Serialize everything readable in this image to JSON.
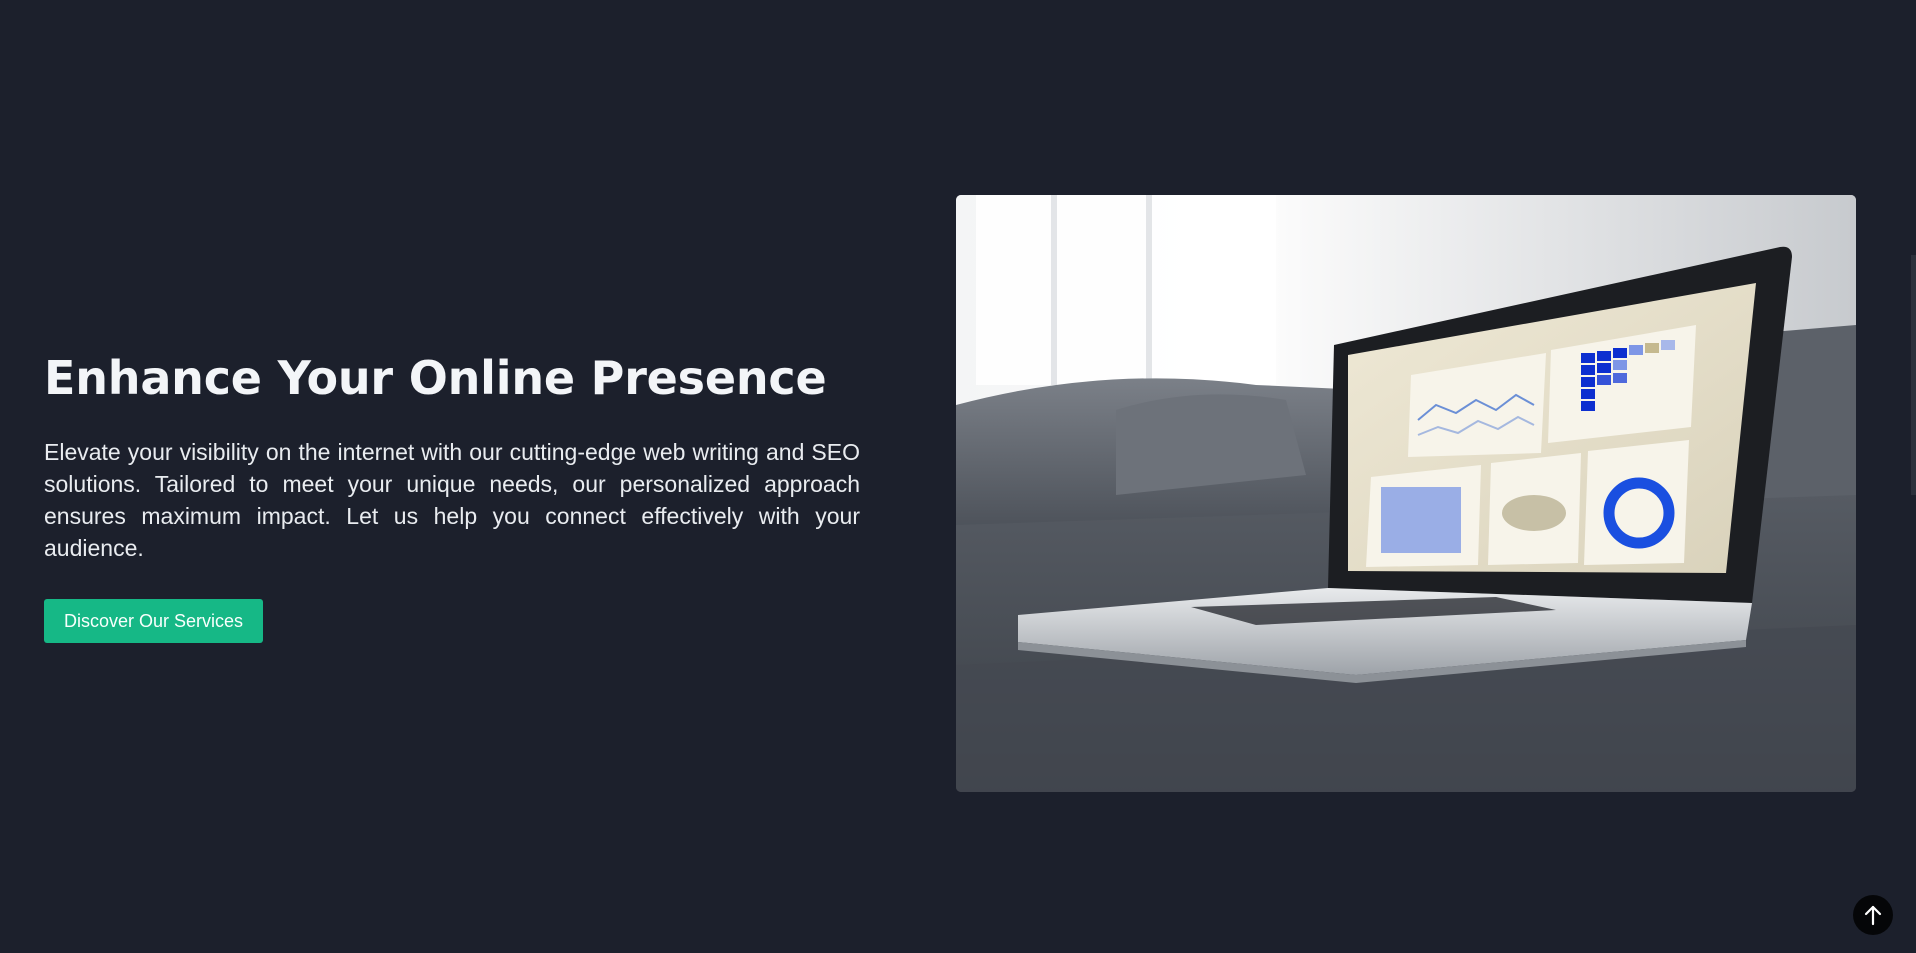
{
  "hero": {
    "title": "Enhance Your Online Presence",
    "description": "Elevate your visibility on the internet with our cutting-edge web writing and SEO solutions. Tailored to meet your unique needs, our personalized approach ensures maximum impact. Let us help you connect effectively with your audience.",
    "cta_label": "Discover Our Services"
  },
  "image": {
    "subject": "laptop showing analytics dashboard on a sofa"
  },
  "icons": {
    "scroll_top": "arrow-up-icon"
  },
  "colors": {
    "background": "#1c202c",
    "accent": "#16b886",
    "text": "#f2f4f7"
  }
}
